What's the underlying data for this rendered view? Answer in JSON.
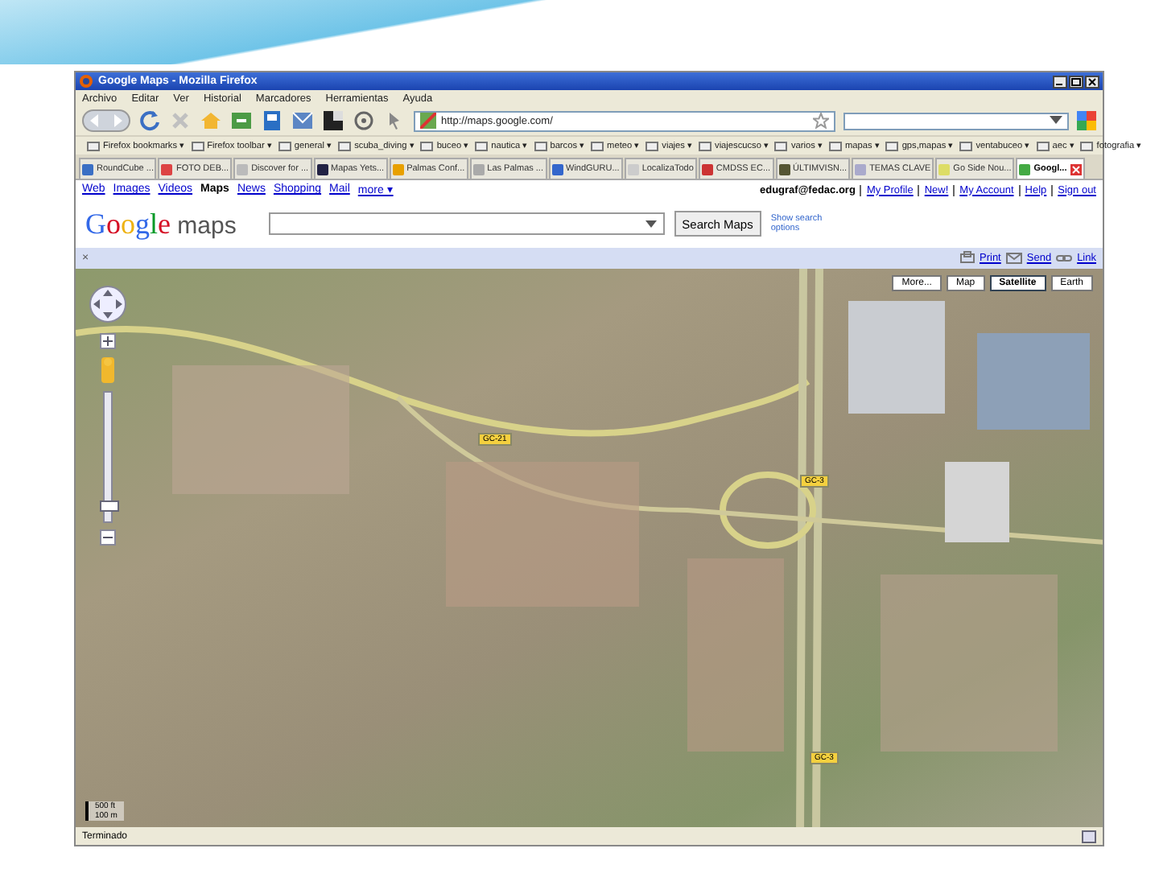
{
  "window": {
    "title": "Google Maps - Mozilla Firefox"
  },
  "menu": [
    "Archivo",
    "Editar",
    "Ver",
    "Historial",
    "Marcadores",
    "Herramientas",
    "Ayuda"
  ],
  "address_bar": {
    "value": "http://maps.google.com/"
  },
  "bookmarks": [
    "Firefox bookmarks ▾",
    "Firefox toolbar ▾",
    "general ▾",
    "scuba_diving ▾",
    "buceo ▾",
    "nautica ▾",
    "barcos ▾",
    "meteo ▾",
    "viajes ▾",
    "viajescucso ▾",
    "varios ▾",
    "mapas ▾",
    "gps,mapas ▾",
    "ventabuceo ▾",
    "aec ▾",
    "fotografia ▾"
  ],
  "tabs": [
    {
      "label": "RoundCube ...",
      "selected": false
    },
    {
      "label": "FOTO DEB...",
      "selected": false
    },
    {
      "label": "Discover for ...",
      "selected": false
    },
    {
      "label": "Mapas Yets...",
      "selected": false
    },
    {
      "label": "Palmas Conf...",
      "selected": false
    },
    {
      "label": "Las Palmas ...",
      "selected": false
    },
    {
      "label": "WindGURU...",
      "selected": false
    },
    {
      "label": "LocalizaTodo",
      "selected": false
    },
    {
      "label": "CMDSS EC...",
      "selected": false
    },
    {
      "label": "ÚLTIMVISN...",
      "selected": false
    },
    {
      "label": "TEMAS CLAVE",
      "selected": false
    },
    {
      "label": "Go Side Nou...",
      "selected": false
    },
    {
      "label": "Googl...",
      "selected": true
    }
  ],
  "google_bar": {
    "links": [
      {
        "label": "Web",
        "selected": false
      },
      {
        "label": "Images",
        "selected": false
      },
      {
        "label": "Videos",
        "selected": false
      },
      {
        "label": "Maps",
        "selected": true
      },
      {
        "label": "News",
        "selected": false
      },
      {
        "label": "Shopping",
        "selected": false
      },
      {
        "label": "Mail",
        "selected": false
      },
      {
        "label": "more ▾",
        "selected": false
      }
    ],
    "user": "edugraf@fedac.org",
    "account_links": [
      "My Profile",
      "New!",
      "My Account",
      "Help",
      "Sign out"
    ]
  },
  "search": {
    "logo_word": "Google",
    "logo_suffix": "maps",
    "button": "Search Maps",
    "options_link": "Show search options"
  },
  "map_bar": {
    "close": "×",
    "actions": [
      "Print",
      "Send",
      "Link"
    ]
  },
  "map": {
    "types": [
      {
        "label": "More...",
        "selected": false
      },
      {
        "label": "Map",
        "selected": false
      },
      {
        "label": "Satellite",
        "selected": true
      },
      {
        "label": "Earth",
        "selected": false
      }
    ],
    "zoom_slider": {
      "level": 0.1
    },
    "shields": [
      "GC-21",
      "GC-3",
      "GC-3"
    ],
    "scale": [
      "500 ft",
      "100 m"
    ]
  },
  "status_bar": {
    "text": "Terminado"
  }
}
